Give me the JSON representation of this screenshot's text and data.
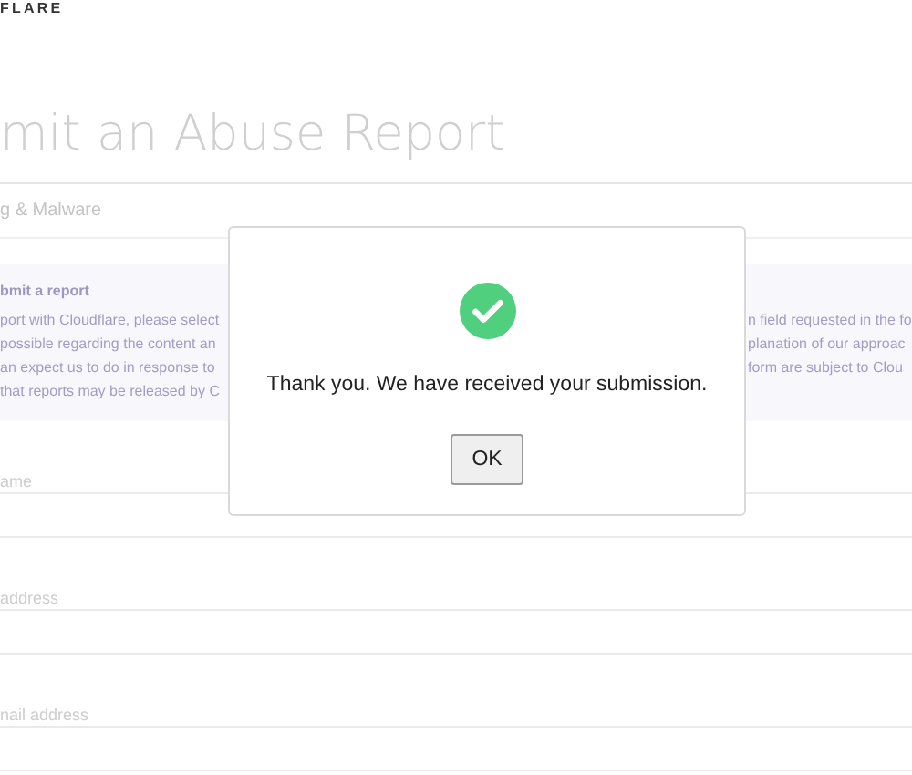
{
  "logo": "FLARE",
  "heading": "mit an Abuse Report",
  "category": "g & Malware",
  "notice": {
    "title": "bmit a report",
    "lines": [
      {
        "left": "port with Cloudflare, please select",
        "right": "n field requested in the fo"
      },
      {
        "left": "possible regarding the content an",
        "right": "planation of our approac"
      },
      {
        "left": "an expect us to do in response to",
        "right": "form are subject to Clou"
      },
      {
        "left": "that reports may be released by C"
      }
    ]
  },
  "fields": [
    {
      "label": "ame"
    },
    {
      "label": "address"
    },
    {
      "label": "nail address"
    }
  ],
  "dialog": {
    "message": "Thank you. We have received your submission.",
    "button": "OK"
  }
}
